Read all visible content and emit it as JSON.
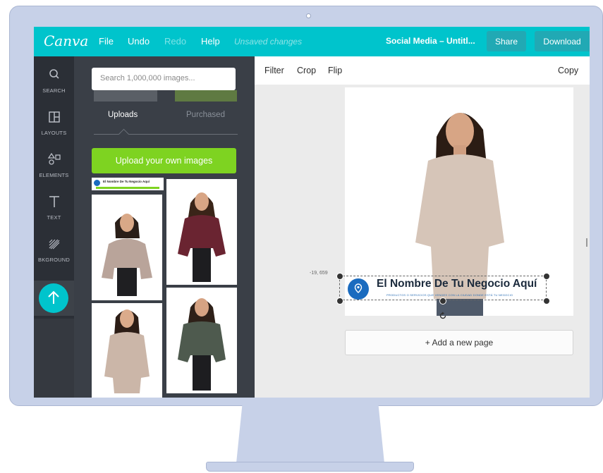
{
  "app": {
    "logo": "Canva",
    "menu": {
      "file": "File",
      "undo": "Undo",
      "redo": "Redo",
      "help": "Help"
    },
    "status": "Unsaved changes",
    "doc_title": "Social Media – Untitl...",
    "share": "Share",
    "download": "Download"
  },
  "rail": {
    "items": [
      {
        "label": "SEARCH",
        "icon": "search-icon"
      },
      {
        "label": "LAYOUTS",
        "icon": "layouts-icon"
      },
      {
        "label": "ELEMENTS",
        "icon": "elements-icon"
      },
      {
        "label": "TEXT",
        "icon": "text-icon"
      },
      {
        "label": "BKGROUND",
        "icon": "background-icon"
      }
    ],
    "active_icon": "upload-arrow-icon"
  },
  "panel": {
    "search_placeholder": "Search 1,000,000 images...",
    "tabs": {
      "uploads": "Uploads",
      "purchased": "Purchased"
    },
    "upload_button": "Upload your own images",
    "logo_thumb_text": "El Nombre De Tu Negocio Aquí"
  },
  "toolbar": {
    "filter": "Filter",
    "crop": "Crop",
    "flip": "Flip",
    "copy": "Copy"
  },
  "canvas": {
    "coords": "-19, 659",
    "business_name": "El Nombre De Tu Negocio Aquí",
    "business_sub": "PRODUCTOS O SERVICIOS QUE VENDES CON LA CIUDAD DONDE ESTÁ TU NEGOCIO",
    "add_page": "+ Add a new page"
  },
  "colors": {
    "topbar": "#00c4cc",
    "rail": "#2b2f36",
    "panel": "#3a3f47",
    "upload_button": "#7ed321",
    "pin": "#1a6bbf"
  }
}
